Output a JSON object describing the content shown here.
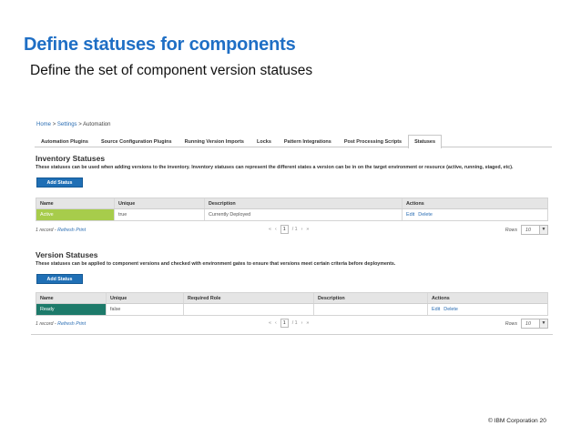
{
  "slide": {
    "title": "Define statuses for components",
    "subtitle": "Define the set of component version statuses",
    "footer": "© IBM Corporation  20"
  },
  "breadcrumb": {
    "home": "Home",
    "settings": "Settings",
    "current": "Automation",
    "sep": ">"
  },
  "tabs": [
    {
      "label": "Automation Plugins"
    },
    {
      "label": "Source Configuration Plugins"
    },
    {
      "label": "Running Version Imports"
    },
    {
      "label": "Locks"
    },
    {
      "label": "Pattern Integrations"
    },
    {
      "label": "Post Processing Scripts"
    },
    {
      "label": "Statuses",
      "active": true
    }
  ],
  "inventory": {
    "title": "Inventory Statuses",
    "description": "These statuses can be used when adding versions to the inventory. Inventory statuses can represent the different states a version can be in on the target environment or resource (active, running, staged, etc).",
    "add_label": "Add Status",
    "columns": [
      "Name",
      "Unique",
      "Description",
      "Actions"
    ],
    "rows": [
      {
        "name": "Active",
        "unique": "true",
        "description": "Currently Deployed",
        "edit": "Edit",
        "delete": "Delete"
      }
    ],
    "pager": {
      "count": "1 record",
      "sep": "-",
      "refresh": "Refresh",
      "print": "Print",
      "first": "«",
      "prev": "‹",
      "page": "1",
      "of": "/ 1",
      "next": "›",
      "last": "»",
      "rows_label": "Rows",
      "rows_value": "10"
    }
  },
  "version": {
    "title": "Version Statuses",
    "description": "These statuses can be applied to component versions and checked with environment gates to ensure that versions meet certain criteria before deployments.",
    "add_label": "Add Status",
    "columns": [
      "Name",
      "Unique",
      "Required Role",
      "Description",
      "Actions"
    ],
    "rows": [
      {
        "name": "Ready",
        "unique": "false",
        "role": "",
        "description": "",
        "edit": "Edit",
        "delete": "Delete"
      }
    ],
    "pager": {
      "count": "1 record",
      "sep": "-",
      "refresh": "Refresh",
      "print": "Print",
      "first": "«",
      "prev": "‹",
      "page": "1",
      "of": "/ 1",
      "next": "›",
      "last": "»",
      "rows_label": "Rows",
      "rows_value": "10"
    }
  },
  "icons": {
    "dropdown": "chevron-down-icon"
  },
  "colors": {
    "title": "#1f6fc5",
    "button": "#1f6fb5",
    "active_row": "#a7cc4b",
    "ready_row": "#1d7a6a",
    "link": "#2a6db3"
  }
}
